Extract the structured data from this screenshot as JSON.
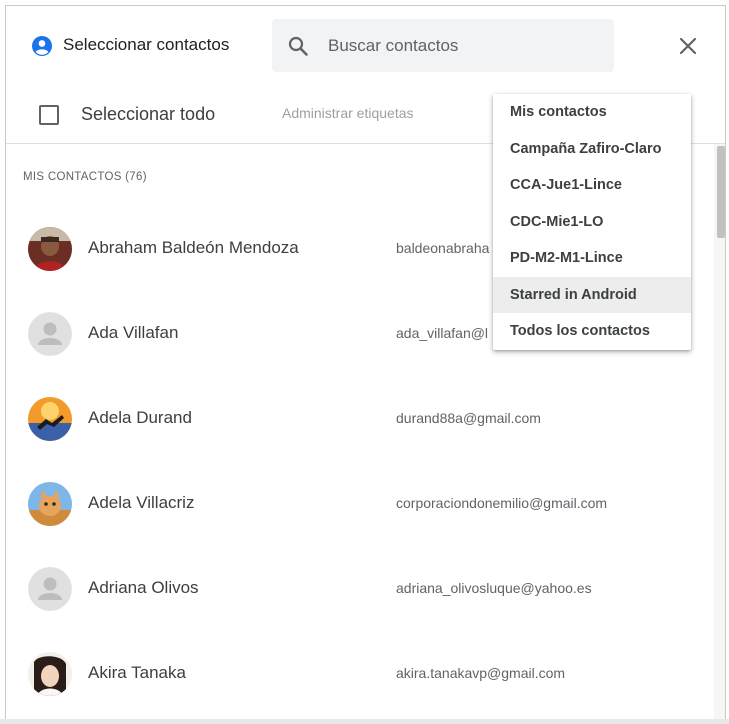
{
  "header": {
    "title": "Seleccionar contactos",
    "search": {
      "placeholder": "Buscar contactos",
      "value": ""
    }
  },
  "toolbar": {
    "select_all_label": "Seleccionar todo",
    "manage_labels": "Administrar etiquetas"
  },
  "list": {
    "section_header": "MIS CONTACTOS (76)",
    "contacts": [
      {
        "name": "Abraham Baldeón Mendoza",
        "email": "baldeonabraha",
        "avatar": "photo"
      },
      {
        "name": "Ada Villafan",
        "email": "ada_villafan@l",
        "avatar": "default"
      },
      {
        "name": "Adela Durand",
        "email": "durand88a@gmail.com",
        "avatar": "photo"
      },
      {
        "name": "Adela Villacriz",
        "email": "corporaciondonemilio@gmail.com",
        "avatar": "photo"
      },
      {
        "name": "Adriana Olivos",
        "email": "adriana_olivosluque@yahoo.es",
        "avatar": "default"
      },
      {
        "name": "Akira Tanaka",
        "email": "akira.tanakavp@gmail.com",
        "avatar": "photo"
      }
    ]
  },
  "menu": {
    "items": [
      {
        "label": "Mis contactos"
      },
      {
        "label": "Campaña Zafiro-Claro"
      },
      {
        "label": "CCA-Jue1-Lince"
      },
      {
        "label": "CDC-Mie1-LO"
      },
      {
        "label": "PD-M2-M1-Lince"
      },
      {
        "label": "Starred in Android",
        "highlighted": true
      },
      {
        "label": "Todos los contactos"
      }
    ]
  },
  "colors": {
    "accent": "#1a73e8",
    "search_bg": "#f1f3f4",
    "menu_highlight": "#ededed",
    "default_avatar_bg": "#e0e0e0"
  },
  "icons": {
    "account": "account-circle-icon",
    "search": "search-icon",
    "close": "close-icon"
  }
}
